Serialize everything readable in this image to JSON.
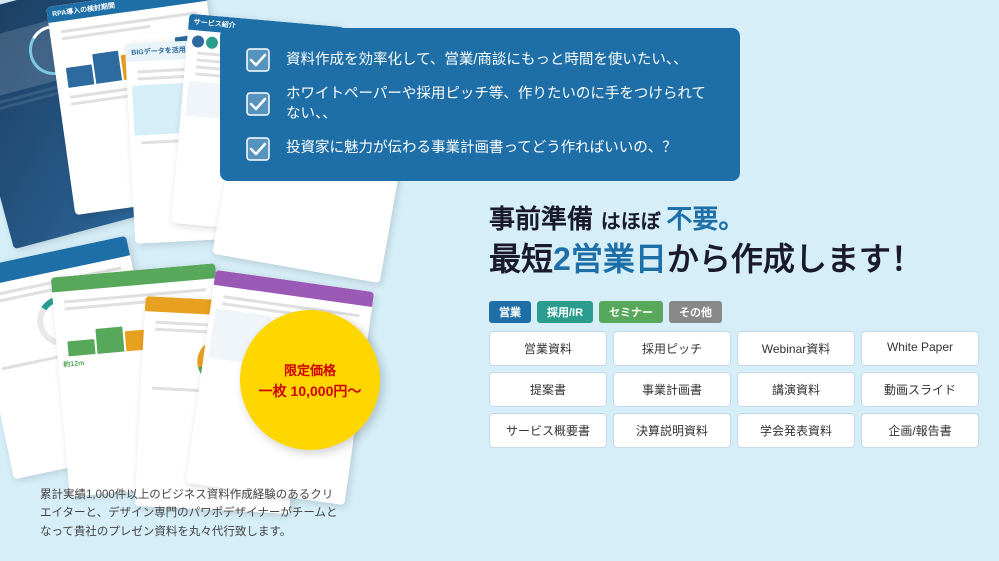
{
  "checklist": {
    "items": [
      "資料作成を効率化して、営業/商談にもっと時間を使いたい、、",
      "ホワイトペーパーや採用ピッチ等、作りたいのに手をつけられてない、、",
      "投資家に魅力が伝わる事業計画書ってどう作ればいいの、？"
    ]
  },
  "headline": {
    "line1_normal": "事前準備",
    "line1_mid": " はほぼ ",
    "line1_emphasis": "不要。",
    "line2_prefix": "最短",
    "line2_emphasis": "2営業日",
    "line2_suffix": "から作成します！"
  },
  "price": {
    "label": "限定価格",
    "value": "一枚 10,000円〜"
  },
  "tags": [
    {
      "label": "営業",
      "color": "blue"
    },
    {
      "label": "採用/IR",
      "color": "teal"
    },
    {
      "label": "セミナー",
      "color": "green"
    },
    {
      "label": "その他",
      "color": "gray"
    }
  ],
  "services": [
    "営業資料",
    "採用ピッチ",
    "Webinar資料",
    "White Paper",
    "",
    "提案書",
    "事業計画書",
    "講演資料",
    "動画スライド",
    "",
    "サービス概要書",
    "決算説明資料",
    "学会発表資料",
    "企画/報告書",
    ""
  ],
  "services_grid": [
    [
      "営業資料",
      "採用ピッチ",
      "Webinar資料",
      "White Paper"
    ],
    [
      "提案書",
      "事業計画書",
      "講演資料",
      "動画スライド"
    ],
    [
      "サービス概要書",
      "決算説明資料",
      "学会発表資料",
      "企画/報告書"
    ]
  ],
  "description": "累計実績1,000件以上のビジネス資料作成経験のあるクリエイターと、デザイン専門のパワポデザイナーがチームとなって貴社のプレゼン資料を丸々代行致します。"
}
